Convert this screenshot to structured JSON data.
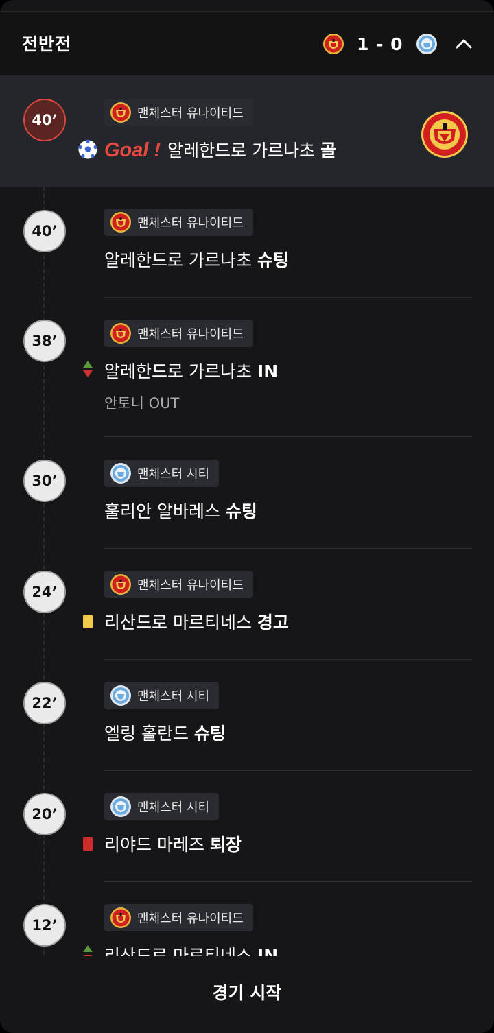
{
  "header": {
    "title": "전반전",
    "score": "1 - 0",
    "home_crest": "man-utd-crest-icon",
    "away_crest": "man-city-crest-icon",
    "toggle_icon": "chevron-up-icon"
  },
  "events": [
    {
      "minute": "40’",
      "team": "맨체스터 유나이티드",
      "goal_word": "Goal !",
      "player": "알레한드로 가르나초",
      "action": "골"
    },
    {
      "minute": "40’",
      "team": "맨체스터 유나이티드",
      "player": "알레한드로 가르나초",
      "action": "슈팅"
    },
    {
      "minute": "38’",
      "team": "맨체스터 유나이티드",
      "player": "알레한드로 가르나초",
      "action": "IN",
      "sub_text": "안토니  OUT"
    },
    {
      "minute": "30’",
      "team": "맨체스터 시티",
      "player": "훌리안 알바레스",
      "action": "슈팅"
    },
    {
      "minute": "24’",
      "team": "맨체스터 유나이티드",
      "player": "리산드로 마르티네스",
      "action": "경고"
    },
    {
      "minute": "22’",
      "team": "맨체스터 시티",
      "player": "엘링 홀란드",
      "action": "슈팅"
    },
    {
      "minute": "20’",
      "team": "맨체스터 시티",
      "player": "리야드 마레즈",
      "action": "퇴장"
    },
    {
      "minute": "12’",
      "team": "맨체스터 유나이티드",
      "player": "리산드로 마르티네스",
      "action": "IN"
    }
  ],
  "footer": {
    "label": "경기 시작"
  },
  "colors": {
    "panel": "#161618",
    "header": "#131314",
    "goal_row": "#25262b",
    "goal_red": "#e8493f",
    "yellow_card": "#f4c84a",
    "red_card": "#d02b2b",
    "sub_in": "#5a9a3a",
    "sub_out": "#d0322b"
  }
}
